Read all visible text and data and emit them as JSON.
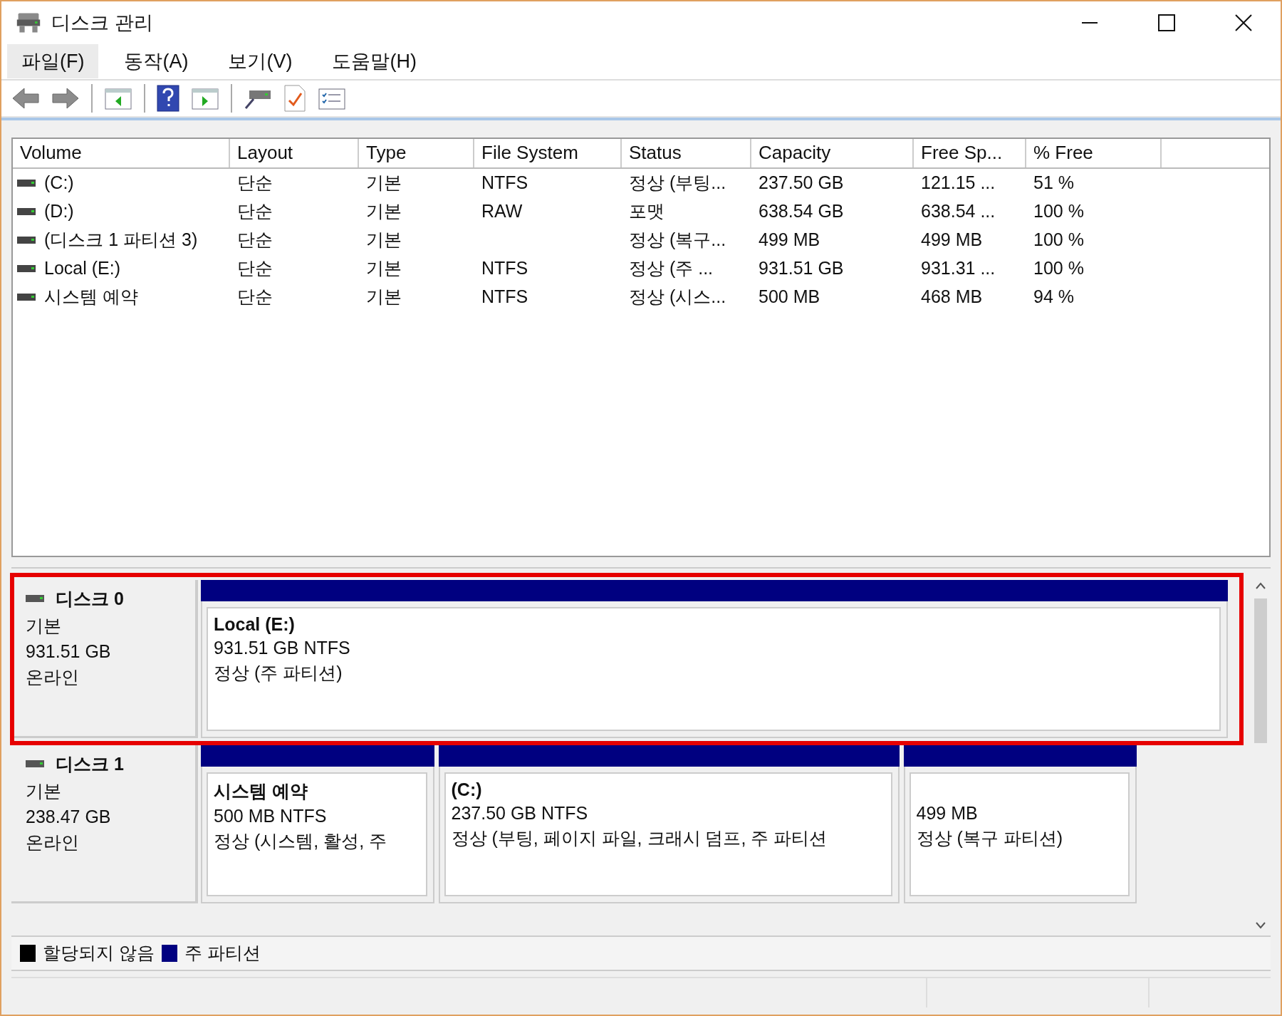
{
  "window": {
    "title": "디스크 관리"
  },
  "menu": [
    {
      "label": "파일(F)",
      "selected": true
    },
    {
      "label": "동작(A)",
      "selected": false
    },
    {
      "label": "보기(V)",
      "selected": false
    },
    {
      "label": "도움말(H)",
      "selected": false
    }
  ],
  "table": {
    "columns": [
      "Volume",
      "Layout",
      "Type",
      "File System",
      "Status",
      "Capacity",
      "Free Sp...",
      "% Free"
    ],
    "rows": [
      [
        "(C:)",
        "단순",
        "기본",
        "NTFS",
        "정상 (부팅...",
        "237.50 GB",
        "121.15 ...",
        "51 %"
      ],
      [
        "(D:)",
        "단순",
        "기본",
        "RAW",
        "포맷",
        "638.54 GB",
        "638.54 ...",
        "100 %"
      ],
      [
        "(디스크 1 파티션 3)",
        "단순",
        "기본",
        "",
        "정상 (복구...",
        "499 MB",
        "499 MB",
        "100 %"
      ],
      [
        "Local (E:)",
        "단순",
        "기본",
        "NTFS",
        "정상 (주 ...",
        "931.51 GB",
        "931.31 ...",
        "100 %"
      ],
      [
        "시스템 예약",
        "단순",
        "기본",
        "NTFS",
        "정상 (시스...",
        "500 MB",
        "468 MB",
        "94 %"
      ]
    ]
  },
  "disks": [
    {
      "name": "디스크 0",
      "type": "기본",
      "size": "931.51 GB",
      "status": "온라인",
      "highlighted": true,
      "partitions": [
        {
          "name": "Local   (E:)",
          "detail": "931.51 GB NTFS",
          "status": "정상 (주 파티션)"
        }
      ]
    },
    {
      "name": "디스크 1",
      "type": "기본",
      "size": "238.47 GB",
      "status": "온라인",
      "highlighted": false,
      "partitions": [
        {
          "name": "시스템 예약",
          "detail": "500 MB NTFS",
          "status": "정상 (시스템, 활성, 주"
        },
        {
          "name": "(C:)",
          "detail": "237.50 GB NTFS",
          "status": "정상 (부팅, 페이지 파일, 크래시 덤프, 주 파티션"
        },
        {
          "detail": "499 MB",
          "status": "정상 (복구 파티션)"
        }
      ]
    }
  ],
  "legend": [
    {
      "label": "할당되지 않음",
      "color": "#000000"
    },
    {
      "label": "주 파티션",
      "color": "#000080"
    }
  ]
}
